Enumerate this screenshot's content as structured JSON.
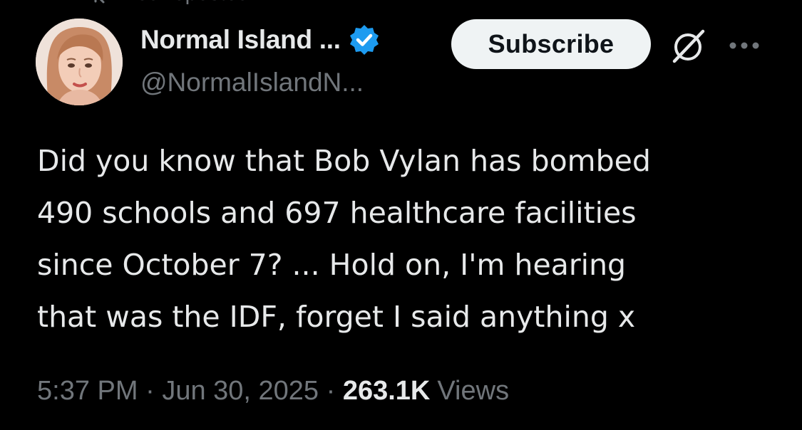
{
  "repost_banner": {
    "label": "You reposted"
  },
  "author": {
    "display_name": "Normal Island ...",
    "handle": "@NormalIslandN...",
    "verified": true
  },
  "actions": {
    "subscribe_label": "Subscribe"
  },
  "tweet": {
    "text_lines": [
      "Did you know that Bob Vylan has bombed",
      "490 schools and 697 healthcare facilities",
      "since October 7? ... Hold on, I'm hearing",
      "that was the IDF, forget I said anything x"
    ]
  },
  "meta": {
    "time": "5:37 PM",
    "separator": "·",
    "date": "Jun 30, 2025",
    "views_count": "263.1K",
    "views_label": "Views"
  },
  "colors": {
    "background": "#000000",
    "primary_text": "#e7e9ea",
    "secondary_text": "#71767b",
    "verified_badge": "#1d9bf0",
    "button_bg": "#eff3f4"
  },
  "icons": {
    "repost": "repost-icon",
    "verified": "verified-badge-icon",
    "grok": "grok-icon",
    "more": "more-options-icon"
  }
}
